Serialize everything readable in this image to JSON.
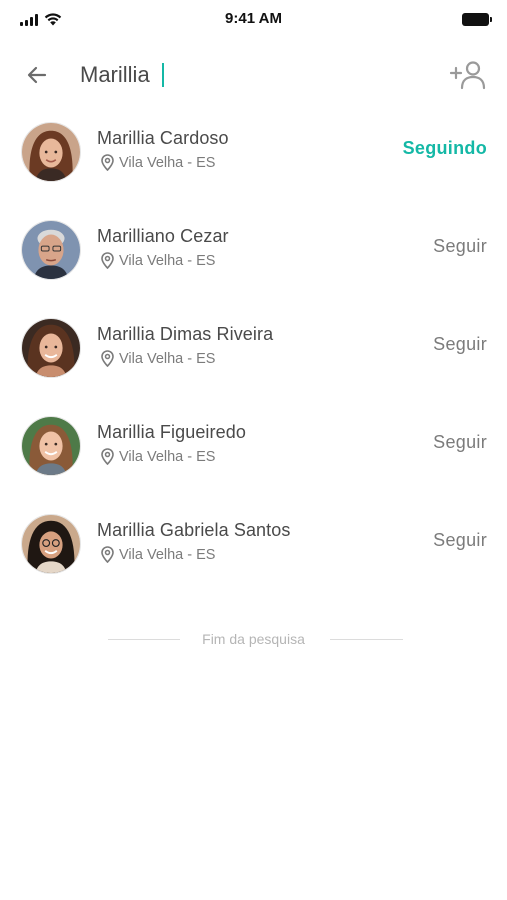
{
  "status_bar": {
    "time": "9:41 AM"
  },
  "search": {
    "value": "Marillia",
    "placeholder": ""
  },
  "icons": {
    "back": "arrow-left-icon",
    "add_user": "add-user-icon",
    "location": "location-pin-icon"
  },
  "results": [
    {
      "name": "Marillia Cardoso",
      "location": "Vila Velha - ES",
      "follow_label": "Seguindo",
      "following": true
    },
    {
      "name": "Marilliano Cezar",
      "location": "Vila Velha - ES",
      "follow_label": "Seguir",
      "following": false
    },
    {
      "name": "Marillia Dimas Riveira",
      "location": "Vila Velha - ES",
      "follow_label": "Seguir",
      "following": false
    },
    {
      "name": "Marillia Figueiredo",
      "location": "Vila Velha - ES",
      "follow_label": "Seguir",
      "following": false
    },
    {
      "name": "Marillia Gabriela Santos",
      "location": "Vila Velha - ES",
      "follow_label": "Seguir",
      "following": false
    }
  ],
  "end_of_search": "Fim da pesquisa",
  "colors": {
    "accent": "#14b8a6",
    "text": "#4a4a4a",
    "muted": "#7b7b7b"
  }
}
